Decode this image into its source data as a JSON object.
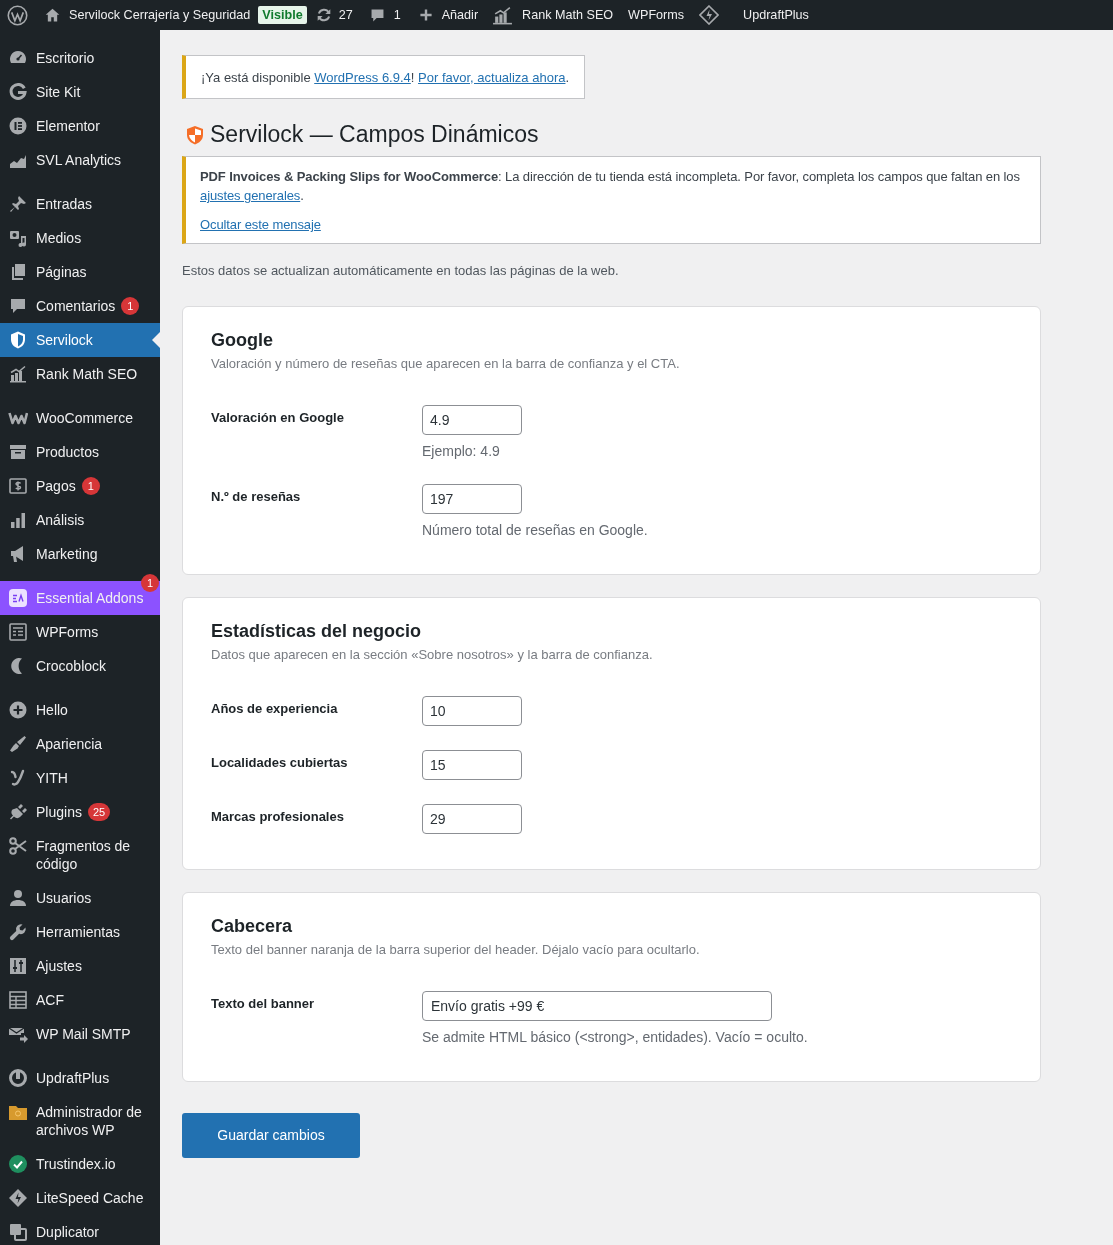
{
  "admin_bar": {
    "site_name": "Servilock Cerrajería y Seguridad",
    "visibility_badge": "Visible",
    "updates_count": "27",
    "comments_count": "1",
    "new_label": "Añadir",
    "rank_math_label": "Rank Math SEO",
    "wpforms_label": "WPForms",
    "updraftplus_label": "UpdraftPlus"
  },
  "sidebar": {
    "groups": [
      {
        "items": [
          {
            "label": "Escritorio",
            "selected": false
          },
          {
            "label": "Site Kit",
            "selected": false
          },
          {
            "label": "Elementor",
            "selected": false
          },
          {
            "label": "SVL Analytics",
            "selected": false
          }
        ]
      },
      {
        "items": [
          {
            "label": "Entradas",
            "selected": false
          },
          {
            "label": "Medios",
            "selected": false
          },
          {
            "label": "Páginas",
            "selected": false
          },
          {
            "label": "Comentarios",
            "selected": false,
            "badge": "1"
          },
          {
            "label": "Servilock",
            "selected": true
          },
          {
            "label": "Rank Math SEO",
            "selected": false
          }
        ]
      },
      {
        "items": [
          {
            "label": "WooCommerce",
            "selected": false
          },
          {
            "label": "Productos",
            "selected": false
          },
          {
            "label": "Pagos",
            "selected": false,
            "badge": "1"
          },
          {
            "label": "Análisis",
            "selected": false
          },
          {
            "label": "Marketing",
            "selected": false
          }
        ]
      },
      {
        "items": [
          {
            "label": "Essential Addons",
            "selected": false,
            "color": "#8c52ff",
            "badge": "1"
          },
          {
            "label": "WPForms",
            "selected": false
          },
          {
            "label": "Crocoblock",
            "selected": false
          }
        ]
      },
      {
        "items": [
          {
            "label": "Hello",
            "selected": false
          },
          {
            "label": "Apariencia",
            "selected": false
          },
          {
            "label": "YITH",
            "selected": false
          },
          {
            "label": "Plugins",
            "selected": false,
            "badge": "25"
          },
          {
            "label": "Fragmentos de código",
            "selected": false
          },
          {
            "label": "Usuarios",
            "selected": false
          },
          {
            "label": "Herramientas",
            "selected": false
          },
          {
            "label": "Ajustes",
            "selected": false
          },
          {
            "label": "ACF",
            "selected": false
          },
          {
            "label": "WP Mail SMTP",
            "selected": false
          }
        ]
      },
      {
        "items": [
          {
            "label": "UpdraftPlus",
            "selected": false
          },
          {
            "label": "Administrador de archivos WP",
            "selected": false
          },
          {
            "label": "Trustindex.io",
            "selected": false
          },
          {
            "label": "LiteSpeed Cache",
            "selected": false
          },
          {
            "label": "Duplicator",
            "selected": false
          }
        ]
      }
    ]
  },
  "update_notice": {
    "paragraphs": [
      {
        "parts": [
          {
            "kind": "text",
            "text": "¡Ya está disponible "
          },
          {
            "kind": "link",
            "text": "WordPress 6.9.4"
          },
          {
            "kind": "text",
            "text": "! "
          },
          {
            "kind": "link",
            "text": "Por favor, actualiza ahora"
          },
          {
            "kind": "text",
            "text": "."
          }
        ]
      }
    ]
  },
  "page_title": "Servilock — Campos Dinámicos",
  "plugin_notice": {
    "paragraphs": [
      {
        "parts": [
          {
            "kind": "strong",
            "text": "PDF Invoices & Packing Slips for WooCommerce"
          },
          {
            "kind": "text",
            "text": ": La dirección de tu tienda está incompleta. Por favor, completa los campos que faltan en los "
          },
          {
            "kind": "link",
            "text": "ajustes generales"
          },
          {
            "kind": "text",
            "text": "."
          }
        ]
      },
      {
        "parts": [
          {
            "kind": "link",
            "text": "Ocultar este mensaje"
          }
        ]
      }
    ]
  },
  "intro": "Estos datos se actualizan automáticamente en todas las páginas de la web.",
  "sections": [
    {
      "title": "Google",
      "description": "Valoración y número de reseñas que aparecen en la barra de confianza y el CTA.",
      "fields": [
        {
          "kind": "number",
          "label": "Valoración en Google",
          "value": "4.9",
          "help": "Ejemplo: 4.9"
        },
        {
          "kind": "number",
          "label": "N.º de reseñas",
          "value": "197",
          "help": "Número total de reseñas en Google."
        }
      ]
    },
    {
      "title": "Estadísticas del negocio",
      "description": "Datos que aparecen en la sección «Sobre nosotros» y la barra de confianza.",
      "fields": [
        {
          "kind": "number",
          "label": "Años de experiencia",
          "value": "10"
        },
        {
          "kind": "number",
          "label": "Localidades cubiertas",
          "value": "15"
        },
        {
          "kind": "number",
          "label": "Marcas profesionales",
          "value": "29"
        }
      ]
    },
    {
      "title": "Cabecera",
      "description": "Texto del banner naranja de la barra superior del header. Déjalo vacío para ocultarlo.",
      "fields": [
        {
          "kind": "text",
          "label": "Texto del banner",
          "value": "Envío gratis +99 €",
          "help": "Se admite HTML básico (<strong>, entidades). Vacío = oculto."
        }
      ]
    }
  ],
  "save_button": "Guardar cambios"
}
